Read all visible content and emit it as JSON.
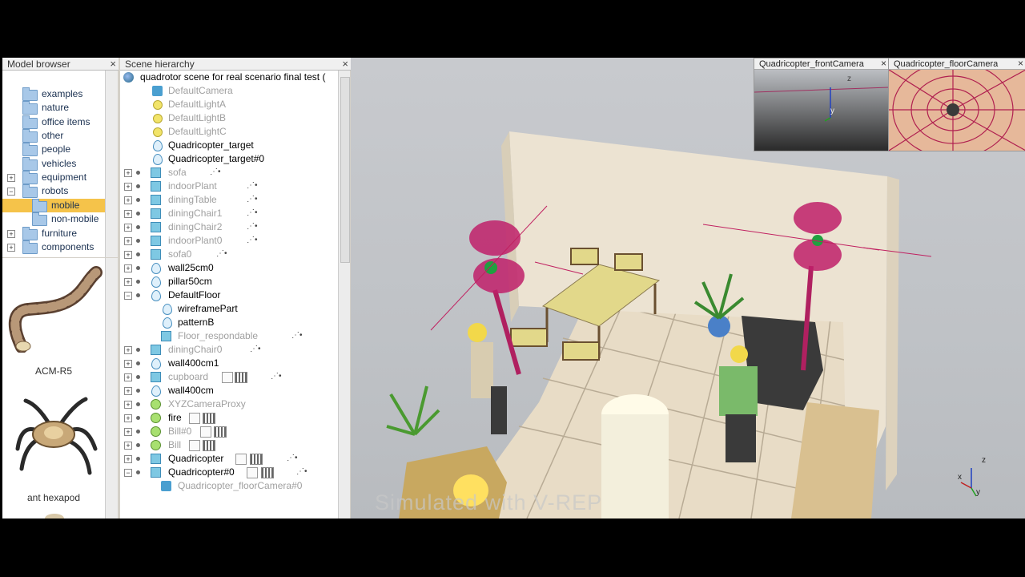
{
  "model_browser": {
    "title": "Model browser",
    "tree": [
      {
        "label": "examples",
        "expandable": false
      },
      {
        "label": "nature",
        "expandable": false
      },
      {
        "label": "office items",
        "expandable": false
      },
      {
        "label": "other",
        "expandable": false
      },
      {
        "label": "people",
        "expandable": false
      },
      {
        "label": "vehicles",
        "expandable": false
      },
      {
        "label": "equipment",
        "expandable": true,
        "expander": "+"
      },
      {
        "label": "robots",
        "expandable": true,
        "expander": "−"
      },
      {
        "label": "mobile",
        "selected": true
      },
      {
        "label": "non-mobile"
      },
      {
        "label": "furniture",
        "expandable": true,
        "expander": "+"
      },
      {
        "label": "components",
        "expandable": true,
        "expander": "+"
      }
    ],
    "thumbnails": [
      {
        "label": "ACM-R5"
      },
      {
        "label": "ant hexapod"
      }
    ]
  },
  "scene_hierarchy": {
    "title": "Scene hierarchy",
    "scene_name": "quadrotor scene for real scenario final test (",
    "rows": [
      {
        "label": "DefaultCamera"
      },
      {
        "label": "DefaultLightA"
      },
      {
        "label": "DefaultLightB"
      },
      {
        "label": "DefaultLightC"
      },
      {
        "label": "Quadricopter_target"
      },
      {
        "label": "Quadricopter_target#0"
      },
      {
        "label": "sofa"
      },
      {
        "label": "indoorPlant"
      },
      {
        "label": "diningTable"
      },
      {
        "label": "diningChair1"
      },
      {
        "label": "diningChair2"
      },
      {
        "label": "indoorPlant0"
      },
      {
        "label": "sofa0"
      },
      {
        "label": "wall25cm0"
      },
      {
        "label": "pillar50cm"
      },
      {
        "label": "DefaultFloor"
      },
      {
        "label": "wireframePart"
      },
      {
        "label": "patternB"
      },
      {
        "label": "Floor_respondable"
      },
      {
        "label": "diningChair0"
      },
      {
        "label": "wall400cm1"
      },
      {
        "label": "cupboard"
      },
      {
        "label": "wall400cm"
      },
      {
        "label": "XYZCameraProxy"
      },
      {
        "label": "fire"
      },
      {
        "label": "Bill#0"
      },
      {
        "label": "Bill"
      },
      {
        "label": "Quadricopter"
      },
      {
        "label": "Quadricopter#0"
      },
      {
        "label": "Quadricopter_floorCamera#0"
      }
    ]
  },
  "views": {
    "front_camera_title": "Quadricopter_frontCamera",
    "floor_camera_title": "Quadricopter_floorCamera"
  },
  "axis_labels": {
    "x": "x",
    "y": "y",
    "z": "z"
  },
  "watermark": "Simulated with V-REP",
  "close_glyph": "×"
}
